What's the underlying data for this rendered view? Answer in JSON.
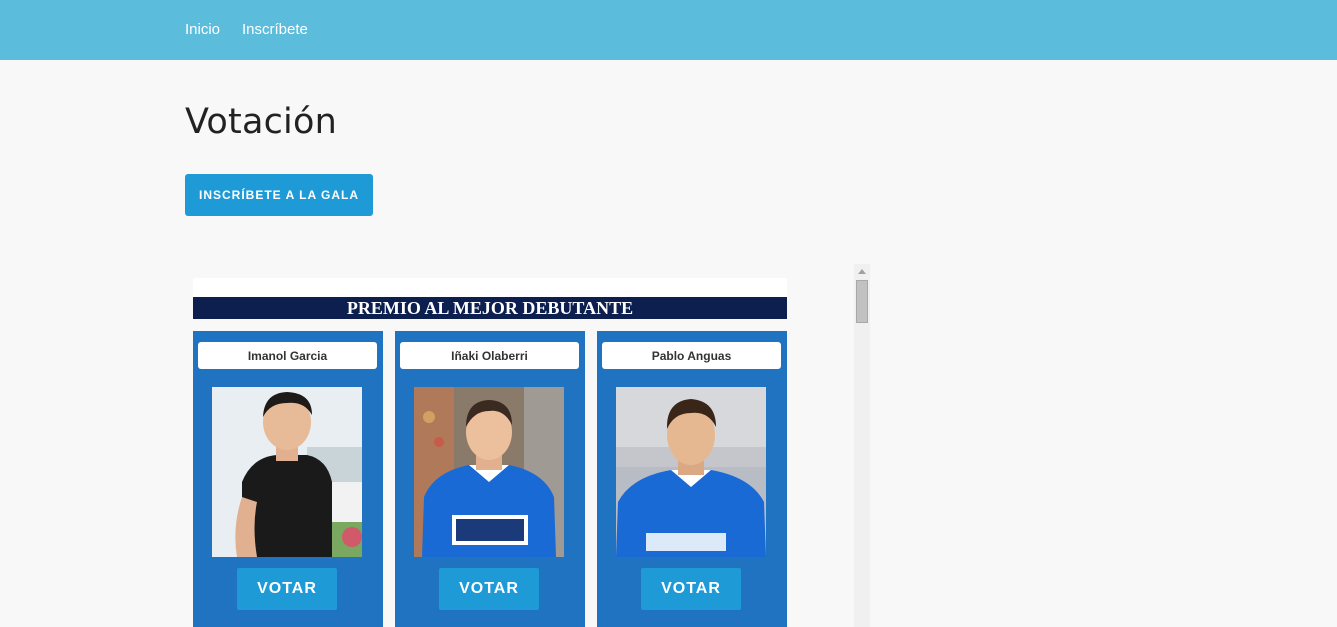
{
  "nav": {
    "inicio": "Inicio",
    "inscribete": "Inscríbete"
  },
  "page": {
    "title": "Votación",
    "cta_label": "INSCRÍBETE A LA GALA"
  },
  "award": {
    "title": "PREMIO AL MEJOR DEBUTANTE",
    "candidates": [
      {
        "name": "Imanol Garcia",
        "vote_label": "VOTAR",
        "photo_icon": "player-photo-black-shirt"
      },
      {
        "name": "Iñaki Olaberri",
        "vote_label": "VOTAR",
        "photo_icon": "player-photo-blue-jersey"
      },
      {
        "name": "Pablo Anguas",
        "vote_label": "VOTAR",
        "photo_icon": "player-photo-blue-jersey"
      }
    ]
  },
  "colors": {
    "navbar": "#5bbcdc",
    "button": "#1e9bd7",
    "card": "#1f73c1",
    "banner": "#0d1f4f"
  }
}
